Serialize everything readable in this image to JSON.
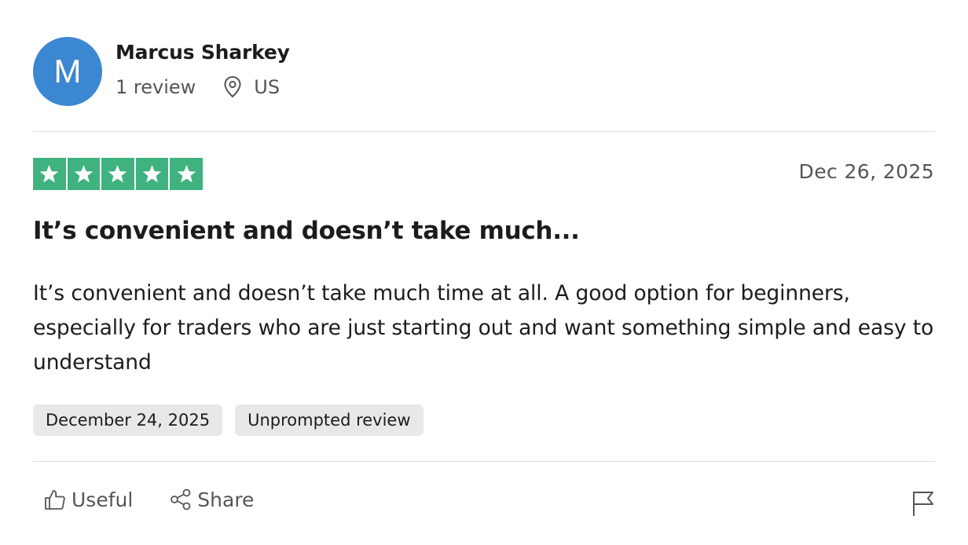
{
  "reviewer": {
    "initial": "M",
    "name": "Marcus Sharkey",
    "review_count": "1 review",
    "country": "US",
    "avatar_color": "#3c87d1"
  },
  "review": {
    "rating": 5,
    "rating_max": 5,
    "star_color": "#3fb27f",
    "date": "Dec 26, 2025",
    "title": "It’s convenient and doesn’t take much...",
    "body": "It’s convenient and doesn’t take much time at all. A good option for beginners, especially for traders who are just starting out and want something simple and easy to understand",
    "tags": {
      "experience_date": "December 24, 2025",
      "review_type": "Unprompted review"
    }
  },
  "actions": {
    "useful_label": "Useful",
    "share_label": "Share",
    "icons": [
      "thumbs-up-icon",
      "share-icon",
      "flag-icon",
      "location-pin-icon",
      "star-icon"
    ]
  }
}
